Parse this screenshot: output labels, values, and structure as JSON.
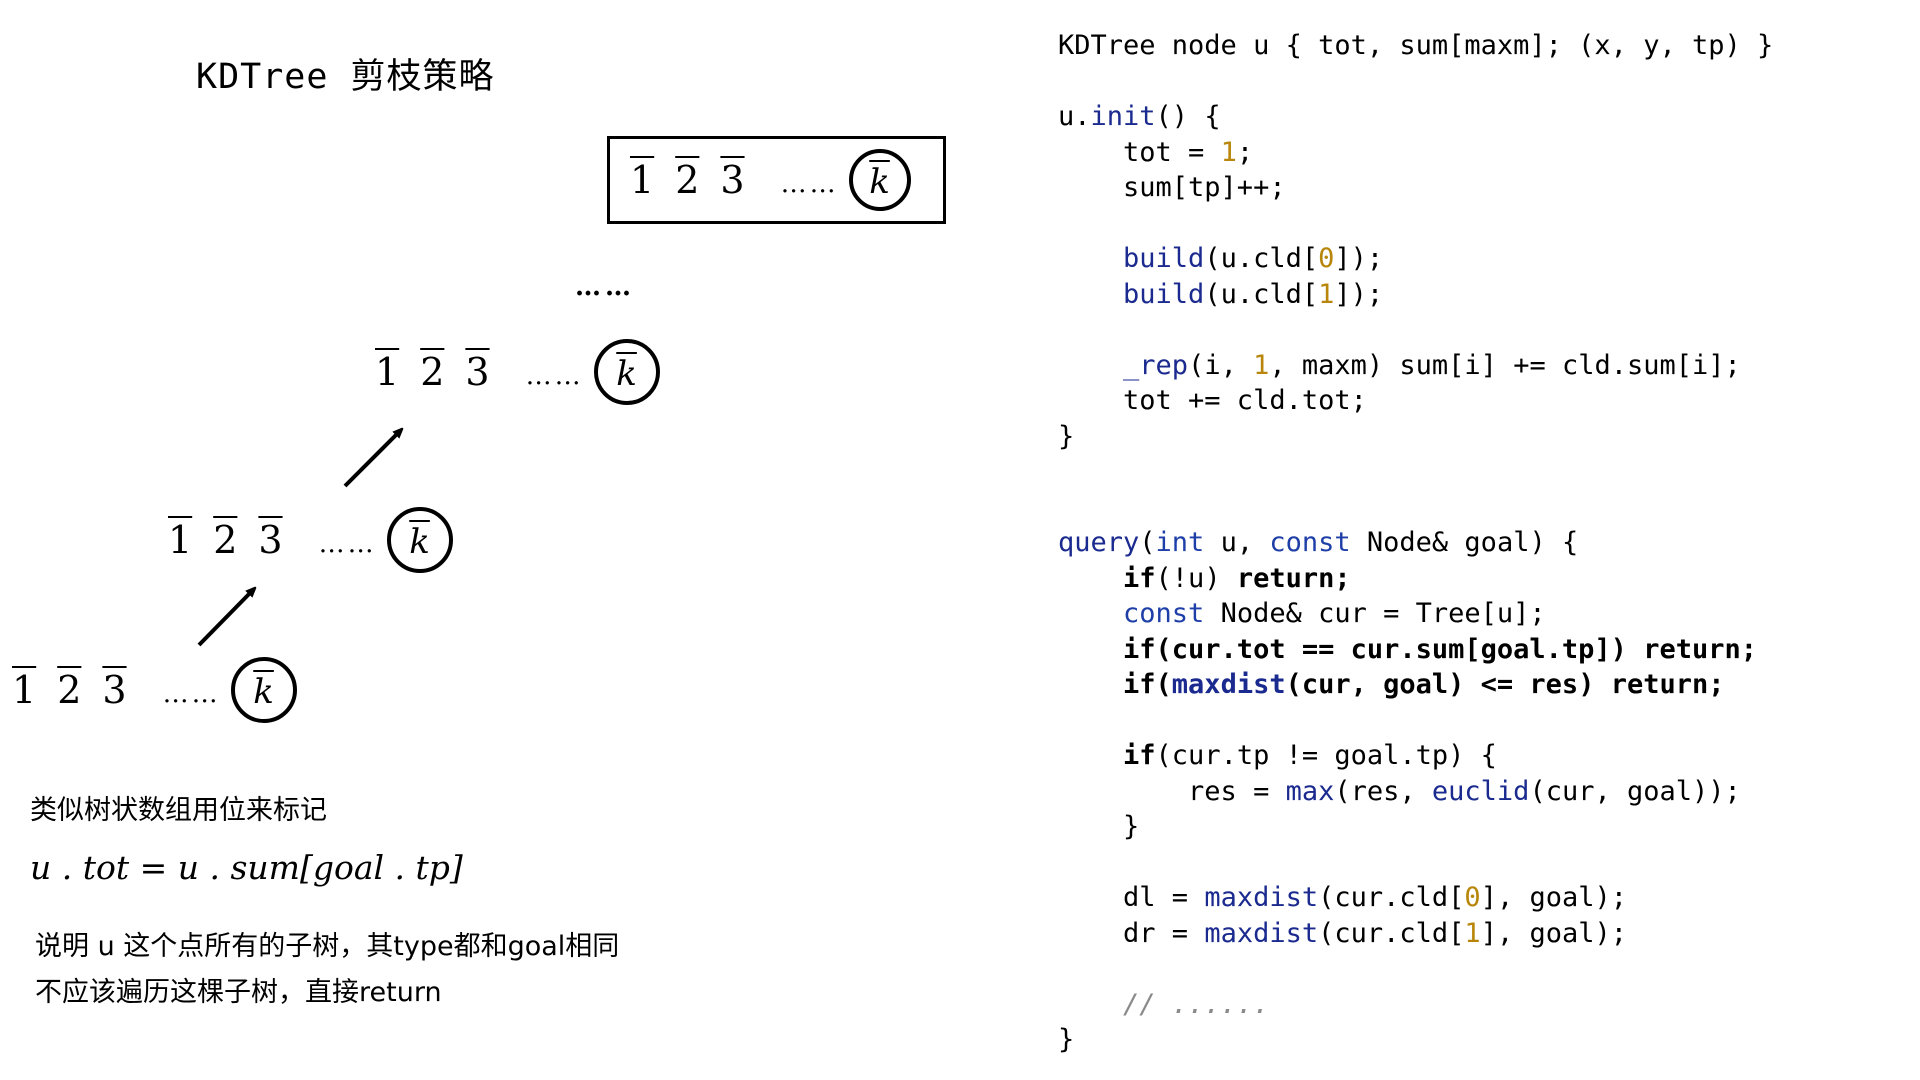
{
  "title": "KDTree 剪枝策略",
  "bits": {
    "labels": [
      "1",
      "2",
      "3"
    ],
    "ellipsis": "……",
    "k": "k",
    "between_dots": "……"
  },
  "left_text": {
    "line1": "类似树状数组用位来标记",
    "formula": "u . tot = u . sum[goal . tp]",
    "explain_line1": "说明 u 这个点所有的子树，其type都和goal相同",
    "explain_line2": "不应该遍历这棵子树，直接return"
  },
  "code": {
    "lines": [
      [
        {
          "t": "KDTree node u { tot, sum[maxm]; (x, y, tp) }"
        }
      ],
      [
        {
          "t": ""
        }
      ],
      [
        {
          "t": "u."
        },
        {
          "t": "init",
          "c": "fn"
        },
        {
          "t": "() {"
        }
      ],
      [
        {
          "t": "    tot = "
        },
        {
          "t": "1",
          "c": "num-lit"
        },
        {
          "t": ";"
        }
      ],
      [
        {
          "t": "    sum[tp]++;"
        }
      ],
      [
        {
          "t": ""
        }
      ],
      [
        {
          "t": "    "
        },
        {
          "t": "build",
          "c": "fn"
        },
        {
          "t": "(u.cld["
        },
        {
          "t": "0",
          "c": "num-lit"
        },
        {
          "t": "]);"
        }
      ],
      [
        {
          "t": "    "
        },
        {
          "t": "build",
          "c": "fn"
        },
        {
          "t": "(u.cld["
        },
        {
          "t": "1",
          "c": "num-lit"
        },
        {
          "t": "]);"
        }
      ],
      [
        {
          "t": ""
        }
      ],
      [
        {
          "t": "    "
        },
        {
          "t": "_rep",
          "c": "fn"
        },
        {
          "t": "(i, "
        },
        {
          "t": "1",
          "c": "num-lit"
        },
        {
          "t": ", maxm) sum[i] += cld.sum[i];"
        }
      ],
      [
        {
          "t": "    tot += cld.tot;"
        }
      ],
      [
        {
          "t": "}"
        }
      ],
      [
        {
          "t": ""
        }
      ],
      [
        {
          "t": ""
        }
      ],
      [
        {
          "t": "query",
          "c": "fn"
        },
        {
          "t": "("
        },
        {
          "t": "int",
          "c": "kw"
        },
        {
          "t": " u, "
        },
        {
          "t": "const",
          "c": "kw"
        },
        {
          "t": " Node& goal) {"
        }
      ],
      [
        {
          "t": "    if",
          "c": "bold"
        },
        {
          "t": "(!u) "
        },
        {
          "t": "return;",
          "c": "bold"
        }
      ],
      [
        {
          "t": "    "
        },
        {
          "t": "const",
          "c": "kw"
        },
        {
          "t": " Node& cur = Tree[u];"
        }
      ],
      [
        {
          "t": "    if(cur.tot == cur.sum[goal.tp]) return;",
          "c": "bold"
        }
      ],
      [
        {
          "t": "    if(",
          "c": "bold"
        },
        {
          "t": "maxdist",
          "c": "fn bold"
        },
        {
          "t": "(cur, goal) <= res) return;",
          "c": "bold"
        }
      ],
      [
        {
          "t": ""
        }
      ],
      [
        {
          "t": "    if",
          "c": "bold"
        },
        {
          "t": "(cur.tp != goal.tp) {"
        }
      ],
      [
        {
          "t": "        res = "
        },
        {
          "t": "max",
          "c": "fn"
        },
        {
          "t": "(res, "
        },
        {
          "t": "euclid",
          "c": "fn"
        },
        {
          "t": "(cur, goal));"
        }
      ],
      [
        {
          "t": "    }"
        }
      ],
      [
        {
          "t": ""
        }
      ],
      [
        {
          "t": "    dl = "
        },
        {
          "t": "maxdist",
          "c": "fn"
        },
        {
          "t": "(cur.cld["
        },
        {
          "t": "0",
          "c": "num-lit"
        },
        {
          "t": "], goal);"
        }
      ],
      [
        {
          "t": "    dr = "
        },
        {
          "t": "maxdist",
          "c": "fn"
        },
        {
          "t": "(cur.cld["
        },
        {
          "t": "1",
          "c": "num-lit"
        },
        {
          "t": "], goal);"
        }
      ],
      [
        {
          "t": ""
        }
      ],
      [
        {
          "t": "    // ......",
          "c": "cmt"
        }
      ],
      [
        {
          "t": "}"
        }
      ]
    ]
  }
}
